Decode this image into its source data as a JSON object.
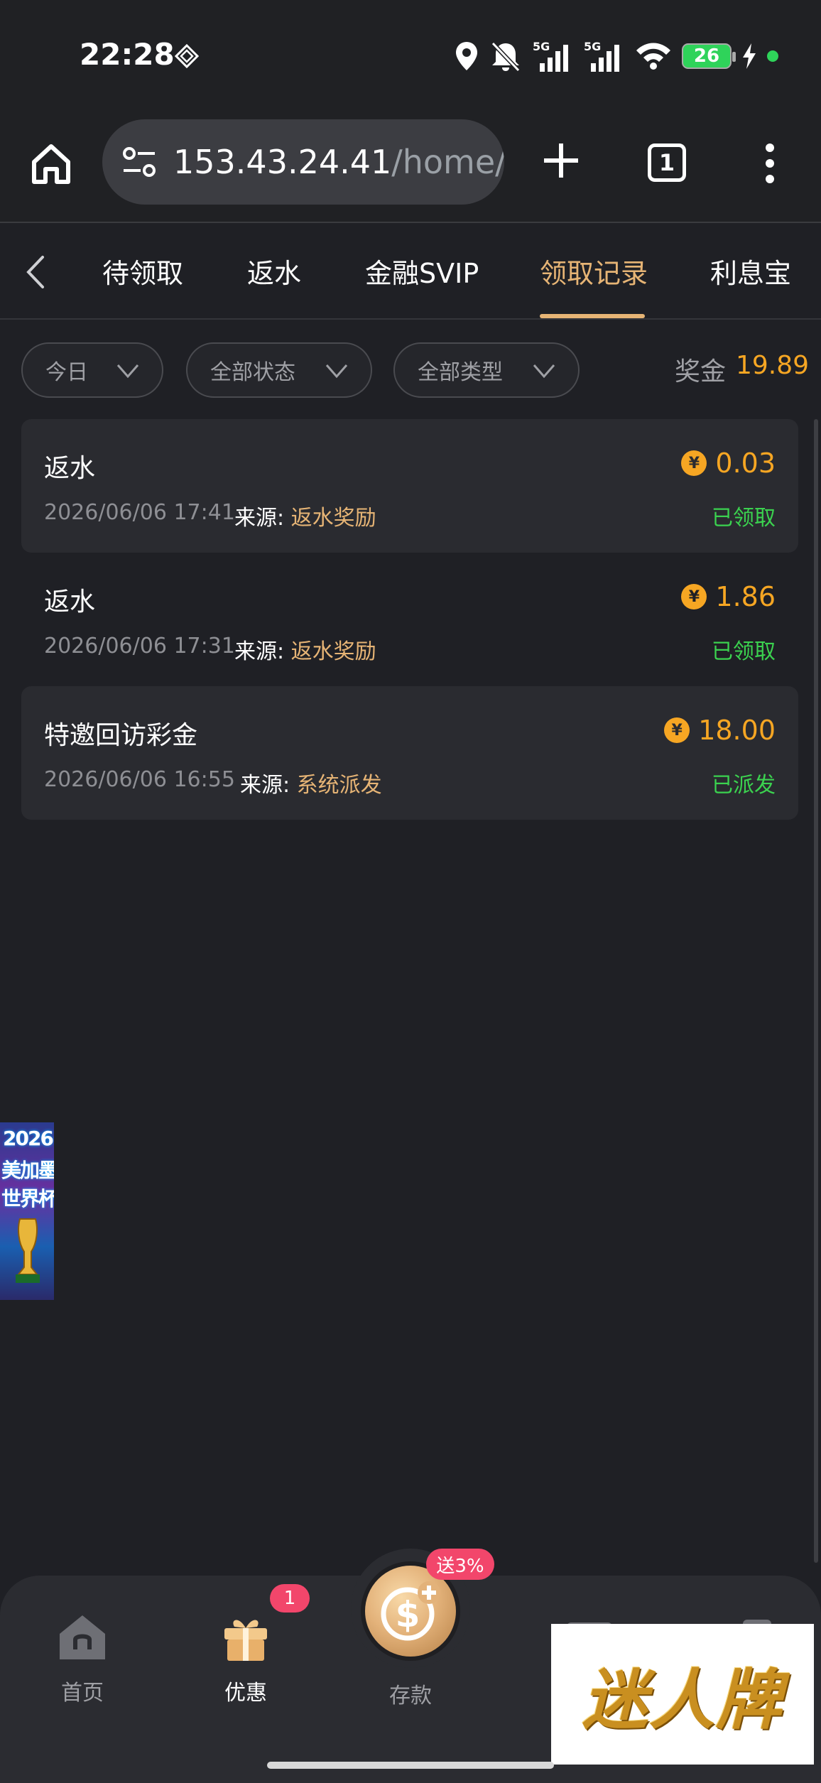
{
  "status_bar": {
    "time": "22:28",
    "icons": [
      "diamond-icon",
      "location-icon",
      "mute-icon",
      "signal-5g-icon",
      "signal-5g-icon",
      "wifi-icon",
      "battery-icon",
      "charging-icon"
    ],
    "battery": "26",
    "network_label": "5G"
  },
  "browser": {
    "url_host": "153.43.24.41",
    "url_path": "/home/re",
    "tab_count": "1"
  },
  "category_tabs": [
    {
      "label": "待领取",
      "active": false
    },
    {
      "label": "返水",
      "active": false
    },
    {
      "label": "金融SVIP",
      "active": false
    },
    {
      "label": "领取记录",
      "active": true
    },
    {
      "label": "利息宝",
      "active": false
    }
  ],
  "filters": {
    "date": "今日",
    "status": "全部状态",
    "type": "全部类型"
  },
  "bonus": {
    "label": "奖金",
    "value": "19.89"
  },
  "records": [
    {
      "title": "返水",
      "amount": "0.03",
      "time": "2026/06/06 17:41",
      "source_label": "来源:",
      "source": "返水奖励",
      "status": "已领取"
    },
    {
      "title": "返水",
      "amount": "1.86",
      "time": "2026/06/06 17:31",
      "source_label": "来源:",
      "source": "返水奖励",
      "status": "已领取"
    },
    {
      "title": "特邀回访彩金",
      "amount": "18.00",
      "time": "2026/06/06 16:55",
      "source_label": "来源:",
      "source": "系统派发",
      "status": "已派发"
    }
  ],
  "currency_symbol": "¥",
  "floating_banner": {
    "line1": "2026",
    "line2": "美加墨",
    "line3": "世界杯"
  },
  "bottom_nav": {
    "home": "首页",
    "promo": "优惠",
    "promo_badge": "1",
    "deposit": "存款",
    "deposit_badge": "送3%"
  },
  "watermark": "迷人牌",
  "colors": {
    "accent_gold": "#e6b475",
    "amount_orange": "#f6a623",
    "status_green": "#3bd24f",
    "badge_pink": "#f2466b",
    "background": "#1f2025"
  }
}
